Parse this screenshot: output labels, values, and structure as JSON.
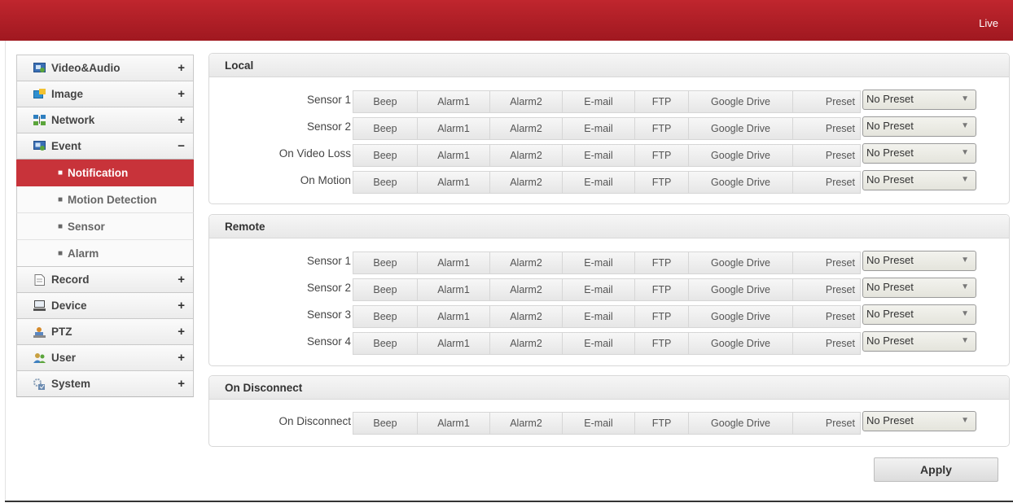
{
  "header": {
    "live_label": "Live"
  },
  "sidebar": {
    "items": [
      {
        "id": "video-audio",
        "label": "Video&Audio",
        "sign": "+",
        "icon": "video-audio-icon",
        "color": "#3a6fb5"
      },
      {
        "id": "image",
        "label": "Image",
        "sign": "+",
        "icon": "image-icon",
        "color": "#2f8fd0"
      },
      {
        "id": "network",
        "label": "Network",
        "sign": "+",
        "icon": "network-icon",
        "color": "#2f7fc0"
      },
      {
        "id": "event",
        "label": "Event",
        "sign": "−",
        "icon": "event-icon",
        "color": "#3a6fb5"
      },
      {
        "id": "record",
        "label": "Record",
        "sign": "+",
        "icon": "record-icon",
        "color": "#888888"
      },
      {
        "id": "device",
        "label": "Device",
        "sign": "+",
        "icon": "device-icon",
        "color": "#555555"
      },
      {
        "id": "ptz",
        "label": "PTZ",
        "sign": "+",
        "icon": "ptz-icon",
        "color": "#d58a2b"
      },
      {
        "id": "user",
        "label": "User",
        "sign": "+",
        "icon": "user-icon",
        "color": "#c8a040"
      },
      {
        "id": "system",
        "label": "System",
        "sign": "+",
        "icon": "system-icon",
        "color": "#6a8ab0"
      }
    ],
    "event_sub": [
      {
        "label": "Notification",
        "active": true
      },
      {
        "label": "Motion Detection",
        "active": false
      },
      {
        "label": "Sensor",
        "active": false
      },
      {
        "label": "Alarm",
        "active": false
      }
    ]
  },
  "buttons": {
    "beep": "Beep",
    "alarm1": "Alarm1",
    "alarm2": "Alarm2",
    "email": "E-mail",
    "ftp": "FTP",
    "gdrive": "Google Drive",
    "preset": "Preset"
  },
  "preset_value": "No Preset",
  "panels": {
    "local": {
      "title": "Local",
      "rows": [
        "Sensor 1",
        "Sensor 2",
        "On Video Loss",
        "On Motion"
      ]
    },
    "remote": {
      "title": "Remote",
      "rows": [
        "Sensor 1",
        "Sensor 2",
        "Sensor 3",
        "Sensor 4"
      ]
    },
    "disconnect": {
      "title": "On Disconnect",
      "rows": [
        "On Disconnect"
      ]
    }
  },
  "apply_label": "Apply",
  "colors": {
    "brand": "#b01f27",
    "active_item": "#c8333a"
  }
}
